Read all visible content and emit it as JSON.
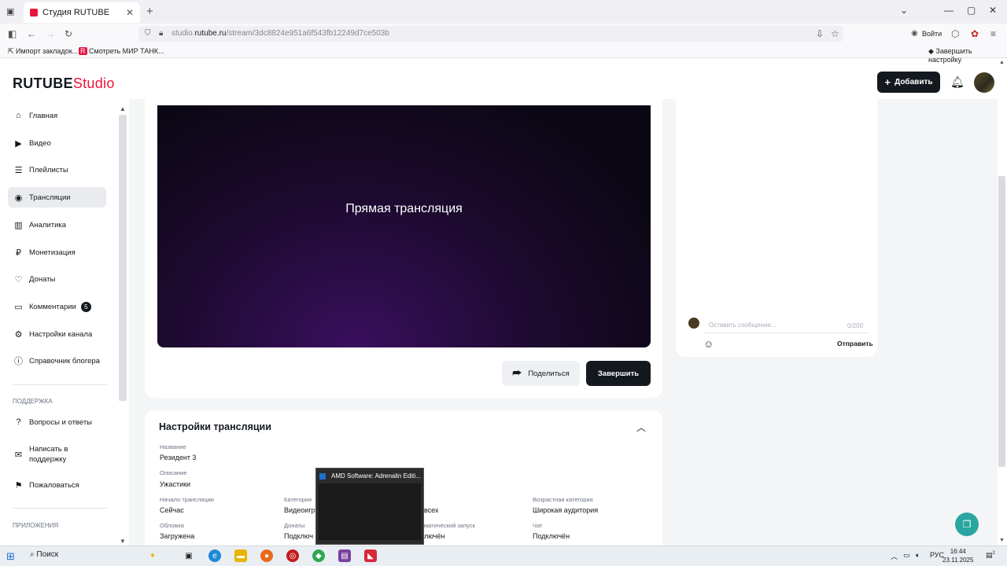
{
  "browser": {
    "tab_title": "Студия RUTUBE",
    "url_prefix": "studio.",
    "url_host": "rutube.ru",
    "url_path": "/stream/3dc8824e951a6f543fb12249d7ce503b",
    "login_label": "Войти",
    "bookmarks": [
      "Импорт закладок...",
      "Смотреть МИР ТАНК..."
    ],
    "finish_setup": "Завершить настройку"
  },
  "header": {
    "logo_main": "RUTUBE",
    "logo_studio": "Studio",
    "add_label": "Добавить"
  },
  "sidebar": {
    "items": [
      {
        "label": "Главная",
        "icon": "home-icon"
      },
      {
        "label": "Видео",
        "icon": "video-icon"
      },
      {
        "label": "Плейлисты",
        "icon": "playlist-icon"
      },
      {
        "label": "Трансляции",
        "icon": "broadcast-icon"
      },
      {
        "label": "Аналитика",
        "icon": "analytics-icon"
      },
      {
        "label": "Монетизация",
        "icon": "ruble-icon"
      },
      {
        "label": "Донаты",
        "icon": "donate-icon"
      },
      {
        "label": "Комментарии",
        "icon": "comment-icon",
        "badge": "5"
      },
      {
        "label": "Настройки канала",
        "icon": "gear-icon"
      },
      {
        "label": "Справочник блогера",
        "icon": "info-icon"
      }
    ],
    "support_label": "ПОДДЕРЖКА",
    "support_items": [
      {
        "label": "Вопросы и ответы",
        "icon": "question-icon"
      },
      {
        "label": "Написать в поддержку",
        "icon": "mail-icon"
      },
      {
        "label": "Пожаловаться",
        "icon": "flag-icon"
      }
    ],
    "apps_label": "ПРИЛОЖЕНИЯ"
  },
  "player": {
    "title": "Прямая трансляция",
    "share_label": "Поделиться",
    "end_label": "Завершить"
  },
  "chat": {
    "placeholder": "Оставить сообщение...",
    "counter": "0/200",
    "send_label": "Отправить"
  },
  "settings": {
    "title": "Настройки трансляции",
    "name_label": "Название",
    "name_value": "Резидент 3",
    "desc_label": "Описание",
    "desc_value": "Ужастики",
    "start_label": "Начало трансляции",
    "start_value": "Сейчас",
    "category_label": "Категория",
    "category_value": "Видеоигр",
    "access_value": "всех",
    "age_label": "Возрастная категория",
    "age_value": "Широкая аудитория",
    "cover_label": "Обложка",
    "cover_value": "Загружена",
    "donations_label": "Донаты",
    "donations_value": "Подключ",
    "autostart_label": "матический запуск",
    "autostart_value": "лючён",
    "chat_label": "Чат",
    "chat_value": "Подключён"
  },
  "taskbar": {
    "search_label": "Поиск",
    "preview_title": "AMD Software: Adrenalin Editi...",
    "lang": "РУС",
    "time": "16:44",
    "date": "23.11.2025",
    "notif_count": "2"
  }
}
